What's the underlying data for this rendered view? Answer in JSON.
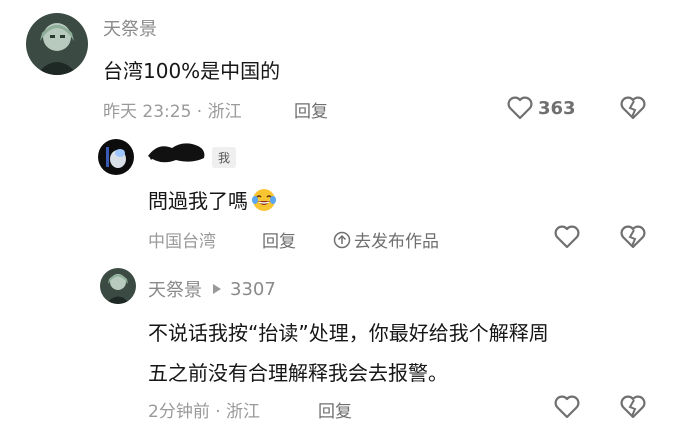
{
  "thread": [
    {
      "author": "天祭景",
      "text": "台湾100%是中国的",
      "time_location": "昨天 23:25 · 浙江",
      "reply_label": "回复",
      "likes": "363"
    },
    {
      "author_badge": "我",
      "text": "問過我了嗎",
      "emoji": "face-with-tears-of-joy",
      "location": "中国台湾",
      "reply_label": "回复",
      "view_works_label": "去发布作品"
    },
    {
      "author": "天祭景",
      "reply_to": "3307",
      "text_line1": "不说话我按“抬读”处理，你最好给我个解释周",
      "text_line2": "五之前没有合理解释我会去报警。",
      "time_location": "2分钟前 · 浙江",
      "reply_label": "回复"
    }
  ],
  "icons": {
    "like": "heart-icon",
    "dislike": "broken-heart-icon",
    "arrow": "arrow-up-circle-icon",
    "reply_arrow": "triangle-right-icon"
  }
}
